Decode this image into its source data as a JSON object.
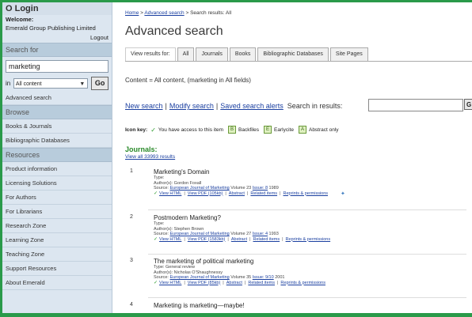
{
  "sidebar": {
    "login_heading": "O Login",
    "welcome_label": "Welcome:",
    "welcome_org": "Emerald Group Publishing Limited",
    "logout": "Logout",
    "search_for_label": "Search for",
    "search_value": "marketing",
    "in_label": "in",
    "scope_selected": "All content",
    "go_button": "Go",
    "advanced_search": "Advanced search",
    "browse_heading": "Browse",
    "browse_items": [
      "Books & Journals",
      "Bibliographic Databases"
    ],
    "resources_heading": "Resources",
    "resource_items": [
      "Product information",
      "Licensing Solutions",
      "For Authors",
      "For Librarians",
      "Research Zone",
      "Learning Zone",
      "Teaching Zone",
      "Support Resources",
      "About Emerald"
    ]
  },
  "main": {
    "breadcrumb": {
      "home": "Home",
      "advanced": "Advanced search",
      "current": "Search results: All"
    },
    "title": "Advanced search",
    "tabs": {
      "view_label": "View results for:",
      "items": [
        "All",
        "Journals",
        "Books",
        "Bibliographic Databases",
        "Site Pages"
      ]
    },
    "content_line": "Content = All content, (marketing in All fields)",
    "search_links": {
      "new": "New search",
      "modify": "Modify search",
      "saved": "Saved search alerts",
      "in_results": "Search in results:",
      "cut_button": "G"
    },
    "icon_key": {
      "label": "Icon key:",
      "access": "You have access to this item",
      "backfiles_letter": "B",
      "backfiles": "Backfiles",
      "earlycite_letter": "E",
      "earlycite": "Earlycite",
      "abstract_letter": "A",
      "abstract": "Abstract only"
    },
    "journals_heading": "Journals:",
    "view_all": "View all 33993 results",
    "link_labels": {
      "view_html": "View HTML",
      "view_pdf": "View PDF (",
      "abstract": "Abstract",
      "related": "Related items",
      "reprints": "Reprints & permissions"
    },
    "results": [
      {
        "num": "1",
        "title": "Marketing's Domain",
        "type": "Type:",
        "authors": "Author(s): Gordon Foxall",
        "source_prefix": "Source: ",
        "source_journal": "European Journal of Marketing",
        "source_vol": " Volume 23 ",
        "source_issue": "Issue: 8",
        "source_year": " 1989",
        "pdf_size": "105kb)"
      },
      {
        "num": "2",
        "title": "Postmodern Marketing?",
        "type": "Type:",
        "authors": "Author(s): Stephen Brown",
        "source_prefix": "Source: ",
        "source_journal": "European Journal of Marketing",
        "source_vol": " Volume 27 ",
        "source_issue": "Issue: 4",
        "source_year": " 1993",
        "pdf_size": "1583kb)"
      },
      {
        "num": "3",
        "title": "The marketing of political marketing",
        "type": "Type: General review",
        "authors": "Author(s): Nicholas O'Shaughnessy",
        "source_prefix": "Source: ",
        "source_journal": "European Journal of Marketing",
        "source_vol": " Volume 35 ",
        "source_issue": "Issue: 9/10",
        "source_year": " 2001",
        "pdf_size": "85kb)"
      },
      {
        "num": "4",
        "title": "Marketing is marketing—maybe!"
      }
    ]
  }
}
